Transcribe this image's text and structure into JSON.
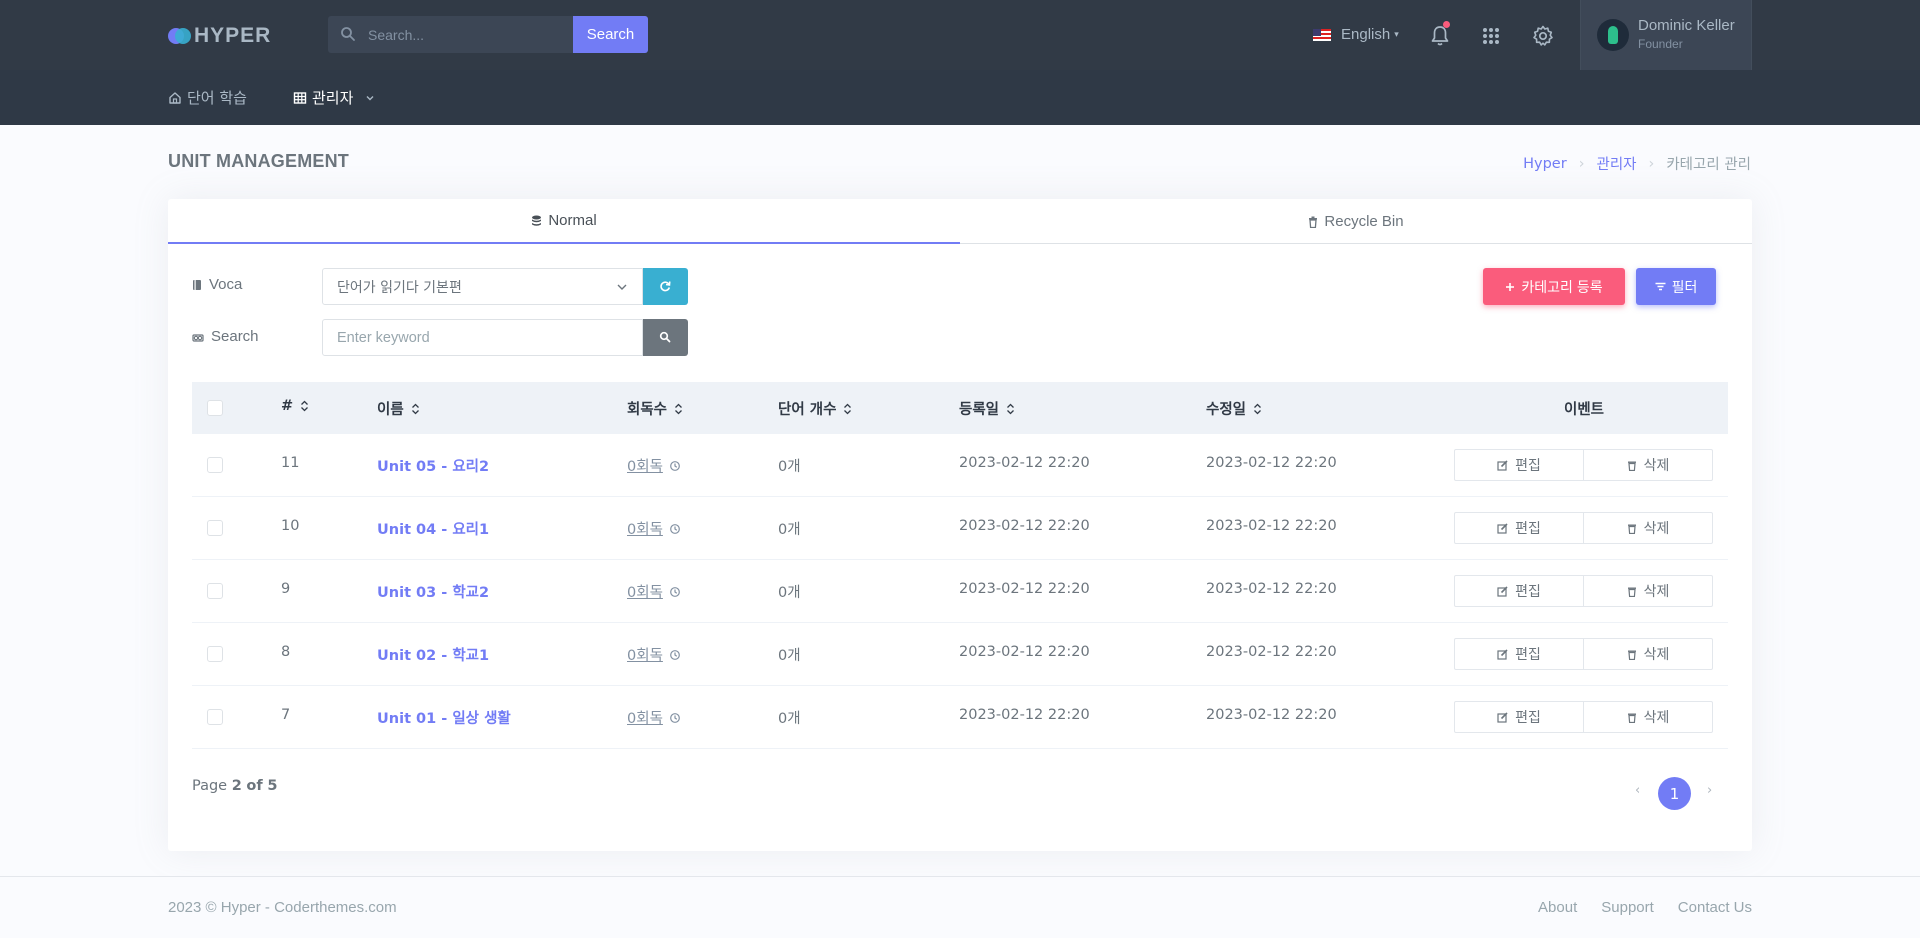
{
  "brand": {
    "name": "HYPER"
  },
  "topbar": {
    "search_placeholder": "Search...",
    "search_button": "Search",
    "language": "English",
    "user": {
      "name": "Dominic Keller",
      "role": "Founder"
    }
  },
  "nav": {
    "home": "단어 학습",
    "admin": "관리자"
  },
  "page": {
    "title": "UNIT MANAGEMENT",
    "breadcrumb": [
      "Hyper",
      "관리자",
      "카테고리 관리"
    ]
  },
  "tabs": {
    "normal": "Normal",
    "recycle": "Recycle Bin"
  },
  "filters": {
    "voca_label": "Voca",
    "voca_value": "단어가 읽기다 기본편",
    "search_label": "Search",
    "keyword_placeholder": "Enter keyword"
  },
  "buttons": {
    "add_category": "카테고리 등록",
    "filter": "필터"
  },
  "table": {
    "headers": {
      "num": "#",
      "name": "이름",
      "reads": "회독수",
      "words": "단어 개수",
      "created": "등록일",
      "updated": "수정일",
      "event": "이벤트"
    },
    "rows": [
      {
        "num": "11",
        "name": "Unit 05 - 요리2",
        "reads": "0회독",
        "words": "0개",
        "created": "2023-02-12 22:20",
        "updated": "2023-02-12 22:20",
        "edit": "편집",
        "delete": "삭제"
      },
      {
        "num": "10",
        "name": "Unit 04 - 요리1",
        "reads": "0회독",
        "words": "0개",
        "created": "2023-02-12 22:20",
        "updated": "2023-02-12 22:20",
        "edit": "편집",
        "delete": "삭제"
      },
      {
        "num": "9",
        "name": "Unit 03 - 학교2",
        "reads": "0회독",
        "words": "0개",
        "created": "2023-02-12 22:20",
        "updated": "2023-02-12 22:20",
        "edit": "편집",
        "delete": "삭제"
      },
      {
        "num": "8",
        "name": "Unit 02 - 학교1",
        "reads": "0회독",
        "words": "0개",
        "created": "2023-02-12 22:20",
        "updated": "2023-02-12 22:20",
        "edit": "편집",
        "delete": "삭제"
      },
      {
        "num": "7",
        "name": "Unit 01 - 일상 생활",
        "reads": "0회독",
        "words": "0개",
        "created": "2023-02-12 22:20",
        "updated": "2023-02-12 22:20",
        "edit": "편집",
        "delete": "삭제"
      }
    ]
  },
  "pagination": {
    "prefix": "Page",
    "current": "2",
    "of": "of",
    "total": "5",
    "active_page": "1",
    "prev": "‹",
    "next": "›"
  },
  "footer": {
    "copyright": "2023 © Hyper - Coderthemes.com",
    "links": [
      "About",
      "Support",
      "Contact Us"
    ]
  },
  "colors": {
    "primary": "#727cf5",
    "danger": "#fa5c7c",
    "info": "#39afd1",
    "topbar": "#313a46"
  },
  "icons": [
    "search-icon",
    "bell-icon",
    "apps-grid-icon",
    "gear-icon",
    "home-icon",
    "table-icon",
    "chevron-down-icon",
    "database-icon",
    "trash-icon",
    "book-icon",
    "refresh-icon",
    "plus-icon",
    "filter-icon",
    "sort-icon",
    "history-icon",
    "edit-icon"
  ]
}
